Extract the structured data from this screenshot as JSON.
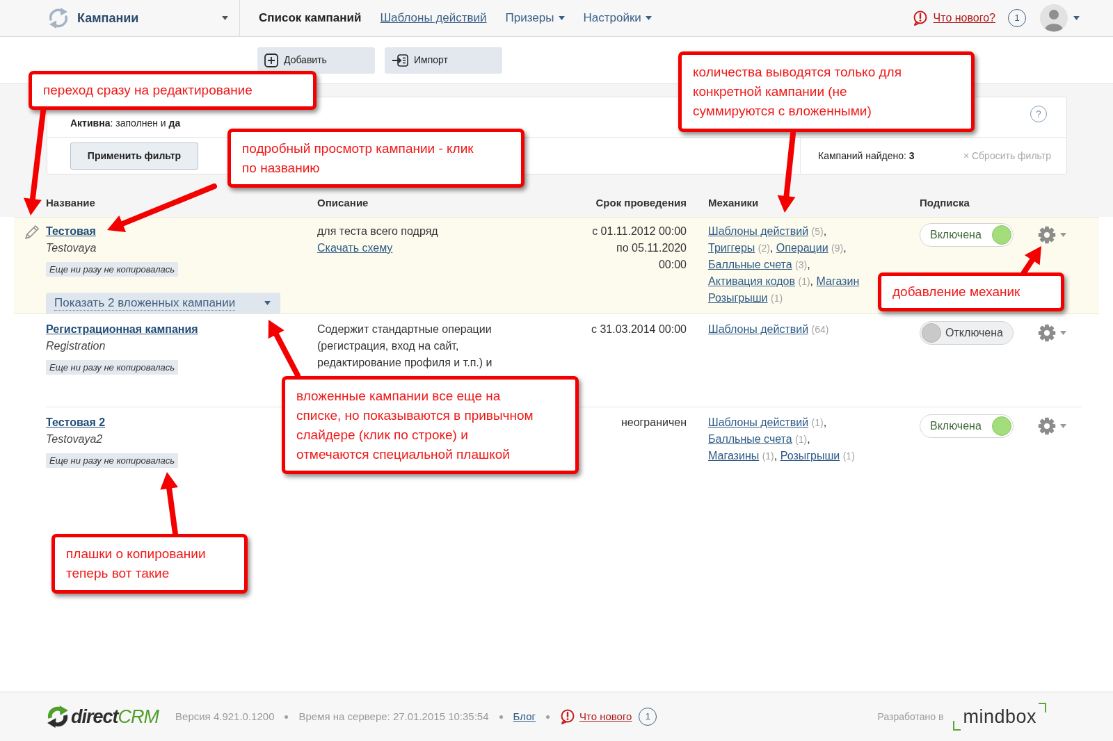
{
  "header": {
    "product": "Кампании",
    "nav": [
      {
        "label": "Список кампаний",
        "kind": "link",
        "selected": true
      },
      {
        "label": "Шаблоны действий",
        "kind": "link",
        "selected": false
      },
      {
        "label": "Призеры",
        "kind": "menu",
        "selected": false
      },
      {
        "label": "Настройки",
        "kind": "menu",
        "selected": false
      }
    ],
    "whats_new": {
      "label": "Что нового?",
      "count": "1"
    }
  },
  "toolbar": [
    {
      "label": "Добавить",
      "kind": "add"
    },
    {
      "label": "Импорт",
      "kind": "import"
    }
  ],
  "filter": {
    "summary": "**Активна**: заполнен и **да**",
    "help": "?",
    "apply": "Применить фильтр",
    "found": "Кампаний найдено: **3**",
    "reset": {
      "icon": "×",
      "label": "Сбросить фильтр"
    }
  },
  "table": {
    "columns": [
      "Название",
      "Описание",
      "Срок проведения",
      "Механики",
      "Подписка"
    ],
    "rows": [
      {
        "hovered": true,
        "name": "Тестовая",
        "code": "Testovaya",
        "copy_status": "Еще ни разу не копировалась",
        "nested_toggle": "Показать 2 вложенных кампании",
        "description": "для теста всего подряд",
        "scheme_link": "Скачать схему",
        "period": [
          "с 01.11.2012 00:00",
          "по 05.11.2020",
          "00:00"
        ],
        "mechanics": [
          {
            "name": "Шаблоны действий",
            "count": "(5)",
            "after": ","
          },
          {
            "name": "Триггеры",
            "count": "(2)",
            "after": ","
          },
          {
            "name": "Операции",
            "count": "(9)",
            "after": ","
          },
          {
            "name": "Балльные счета",
            "count": "(3)",
            "after": ","
          },
          {
            "name": "Активация кодов",
            "count": "(1)",
            "after": ","
          },
          {
            "name": "Магазин"
          },
          {
            "name": "Розыгрыши",
            "count": "(1)"
          }
        ],
        "subscription": {
          "label": "Включена",
          "on": true
        }
      },
      {
        "hovered": false,
        "name": "Регистрационная кампания",
        "code": "Registration",
        "copy_status": "Еще ни разу не копировалась",
        "description": "Содержит стандартные операции (регистрация, вход на сайт, редактирование профиля и т.п.) и",
        "period": [
          "с 31.03.2014 00:00"
        ],
        "mechanics": [
          {
            "name": "Шаблоны действий",
            "count": "(64)"
          }
        ],
        "subscription": {
          "label": "Отключена",
          "on": false
        }
      },
      {
        "hovered": false,
        "name": "Тестовая 2",
        "code": "Testovaya2",
        "copy_status": "Еще ни разу не копировалась",
        "period": [
          "неограничен"
        ],
        "mechanics": [
          {
            "name": "Шаблоны действий",
            "count": "(1)",
            "after": ","
          },
          {
            "name": "Балльные счета",
            "count": "(1)",
            "after": ","
          },
          {
            "name": "Магазины",
            "count": "(1)",
            "after": ","
          },
          {
            "name": "Розыгрыши",
            "count": "(1)"
          }
        ],
        "subscription": {
          "label": "Включена",
          "on": true
        }
      }
    ]
  },
  "annotations": [
    {
      "lines": [
        "переход сразу на редактирование"
      ]
    },
    {
      "lines": [
        "подробный просмотр кампании - клик",
        "по названию"
      ]
    },
    {
      "lines": [
        "количества выводятся только для",
        "конкретной кампании (не",
        "суммируются с вложенными)"
      ]
    },
    {
      "lines": [
        "добавление механик"
      ]
    },
    {
      "lines": [
        "вложенные кампании все еще на",
        "списке, но показываются в привычном",
        "слайдере (клик по строке) и",
        "отмечаются специальной плашкой"
      ]
    },
    {
      "lines": [
        "плашки о копировании",
        "теперь вот такие"
      ]
    }
  ],
  "footer": {
    "logo": {
      "text": "direct",
      "accent": "CRM"
    },
    "version": "Версия 4.921.0.1200",
    "server_time": "Время на сервере: 27.01.2015 10:35:54",
    "blog": "Блог",
    "whats_new": {
      "label": "Что нового",
      "count": "1"
    },
    "developer": {
      "label": "Разработано в",
      "logo": "mindbox"
    }
  }
}
